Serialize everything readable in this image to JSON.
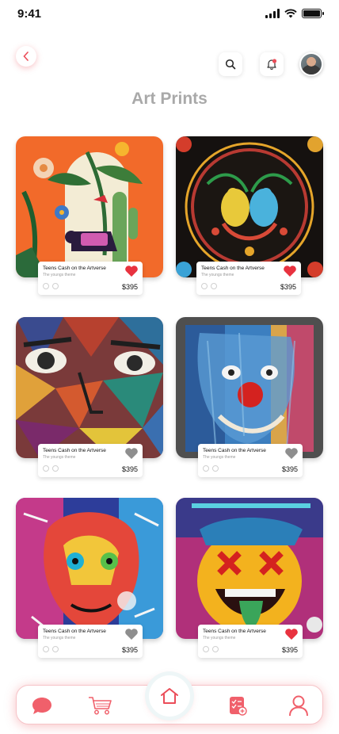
{
  "status_bar": {
    "time": "9:41"
  },
  "header": {
    "title": "Art Prints"
  },
  "icons": {
    "back": "chevron-left-icon",
    "search": "search-icon",
    "notification": "bell-icon",
    "profile": "avatar"
  },
  "colors": {
    "accent": "#eb4d59",
    "heart_active": "#e8323f",
    "heart_inactive": "#8e8e8e",
    "title": "#a9a9a9"
  },
  "products": [
    {
      "name": "Teens Cash on the Artverse",
      "subtitle": "The youngs theme",
      "price": "$395",
      "liked": true
    },
    {
      "name": "Teens Cash on the Artverse",
      "subtitle": "The youngs theme",
      "price": "$395",
      "liked": true
    },
    {
      "name": "Teens Cash on the Artverse",
      "subtitle": "The youngs theme",
      "price": "$395",
      "liked": false
    },
    {
      "name": "Teens Cash on the Artverse",
      "subtitle": "The youngs theme",
      "price": "$395",
      "liked": false
    },
    {
      "name": "Teens Cash on the Artverse",
      "subtitle": "The youngs theme",
      "price": "$395",
      "liked": false
    },
    {
      "name": "Teens Cash on the Artverse",
      "subtitle": "The youngs theme",
      "price": "$395",
      "liked": true
    }
  ],
  "bottom_nav": {
    "items": [
      "chat-icon",
      "cart-icon",
      "home-icon",
      "checklist-icon",
      "user-icon"
    ],
    "active": "home-icon"
  }
}
